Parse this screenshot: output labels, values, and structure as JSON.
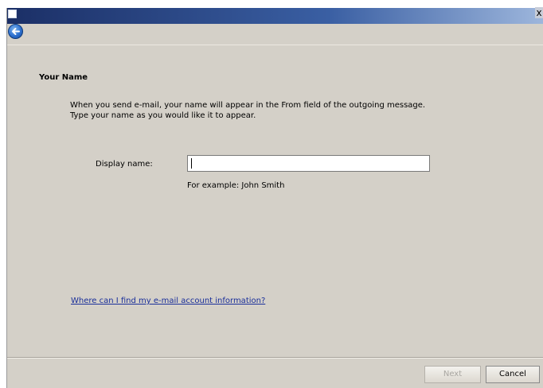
{
  "titlebar": {
    "close_label": "x"
  },
  "page": {
    "heading": "Your Name",
    "description_line1": "When you send e-mail, your name will appear in the From field of the outgoing message.",
    "description_line2": "Type your name as you would like it to appear."
  },
  "form": {
    "display_name_label": "Display name:",
    "display_name_value": "",
    "example_text": "For example: John Smith"
  },
  "help_link": "Where can I find my e-mail account information?",
  "footer": {
    "next_label": "Next",
    "cancel_label": "Cancel"
  },
  "icons": {
    "back": "back-arrow-icon",
    "system": "window-icon"
  },
  "colors": {
    "dialog_bg": "#d4d0c8",
    "titlebar_start": "#1b2f66",
    "titlebar_end": "#9db6dc",
    "link": "#1a2f9a",
    "back_button": "#2c6fcf"
  }
}
